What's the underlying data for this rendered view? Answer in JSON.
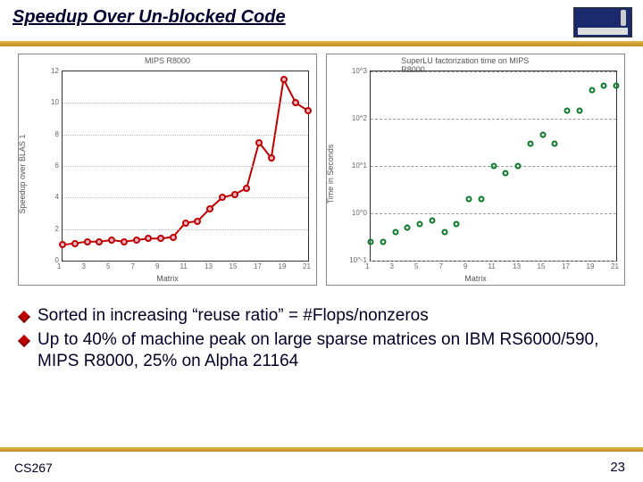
{
  "title": "Speedup Over Un-blocked Code",
  "footer_left": "CS267",
  "footer_right": "23",
  "bullets": [
    "Sorted in increasing “reuse ratio” = #Flops/nonzeros",
    "Up to 40% of machine peak on large sparse matrices on IBM RS6000/590, MIPS R8000, 25% on Alpha 21164"
  ],
  "chart_data": [
    {
      "type": "line",
      "title": "MIPS R8000",
      "xlabel": "Matrix",
      "ylabel": "Speedup over BLAS 1",
      "xlim": [
        1,
        21
      ],
      "ylim": [
        0,
        12
      ],
      "xticks": [
        1,
        3,
        5,
        7,
        9,
        11,
        13,
        15,
        17,
        19,
        21
      ],
      "yticks": [
        0,
        2,
        4,
        6,
        8,
        10,
        12
      ],
      "series": [
        {
          "name": "speedup",
          "color": "#c00000",
          "x": [
            1,
            2,
            3,
            4,
            5,
            6,
            7,
            8,
            9,
            10,
            11,
            12,
            13,
            14,
            15,
            16,
            17,
            18,
            19,
            20,
            21
          ],
          "y": [
            1,
            1.1,
            1.2,
            1.2,
            1.3,
            1.2,
            1.3,
            1.4,
            1.4,
            1.5,
            2.4,
            2.5,
            3.3,
            4.0,
            4.2,
            4.6,
            7.5,
            6.5,
            11.5,
            10.0,
            9.5
          ]
        }
      ]
    },
    {
      "type": "scatter",
      "title": "SuperLU factorization time on MIPS R8000",
      "xlabel": "Matrix",
      "ylabel": "Time in Seconds",
      "yscale": "log",
      "xlim": [
        1,
        21
      ],
      "ylim": [
        0.1,
        1000
      ],
      "xticks": [
        1,
        3,
        5,
        7,
        9,
        11,
        13,
        15,
        17,
        19,
        21
      ],
      "yticks": [
        0.1,
        1,
        10,
        100,
        1000
      ],
      "yticklabels": [
        "10^-1",
        "10^0",
        "10^1",
        "10^2",
        "10^3"
      ],
      "series": [
        {
          "name": "time",
          "color": "#0a7a2a",
          "x": [
            1,
            2,
            3,
            4,
            5,
            6,
            7,
            8,
            9,
            10,
            11,
            12,
            13,
            14,
            15,
            16,
            17,
            18,
            19,
            20,
            21
          ],
          "y": [
            0.25,
            0.25,
            0.4,
            0.5,
            0.6,
            0.7,
            0.4,
            0.6,
            2.0,
            2.0,
            10,
            7,
            10,
            30,
            45,
            30,
            150,
            150,
            400,
            500,
            500
          ]
        }
      ]
    }
  ]
}
